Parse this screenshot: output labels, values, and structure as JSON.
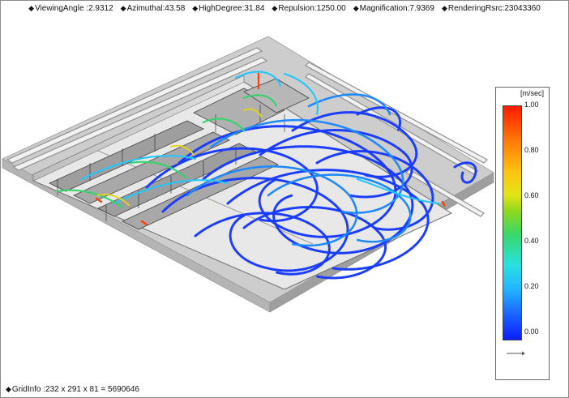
{
  "status": {
    "viewing_angle": "ViewingAngle :2.9312",
    "azimuthal": "Azimuthal:43.58",
    "high_degree": "HighDegree:31.84",
    "repulsion": "Repulsion:1250.00",
    "magnification": "Magnification:7.9369",
    "rendering": "RenderingRsrc:23043360"
  },
  "legend": {
    "unit": "[m/sec]",
    "ticks": [
      "1.00",
      "0.80",
      "0.60",
      "0.40",
      "0.20",
      "0.00"
    ]
  },
  "grid_info": "GridInfo :232 x 291 x 81 = 5690646",
  "colors": {
    "slab_top": "#c9c9c9",
    "slab_side": "#a8a8a8",
    "floor": "#e6e6e6",
    "stream_low": "#1a3cff",
    "stream_mid": "#22c3ff",
    "stream_high": "#ff2a00"
  }
}
